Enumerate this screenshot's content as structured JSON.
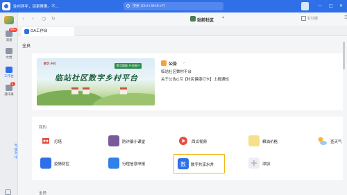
{
  "topbar": {
    "notice": "驻村两年，硕果累累。不...",
    "search_placeholder": "搜索 (Ctrl+Shift+F)",
    "window_controls": [
      "—",
      "□",
      "✕"
    ]
  },
  "sidebar": {
    "items": [
      {
        "label": "消息",
        "badge": "99+",
        "icon": "message-icon"
      },
      {
        "label": "文档",
        "icon": "document-icon"
      },
      {
        "label": "工作台",
        "icon": "workbench-icon",
        "active": true
      },
      {
        "label": "通讯录",
        "badge": "2",
        "icon": "contacts-icon"
      }
    ],
    "side_text": "无锡对比"
  },
  "nav": {
    "back": "‹",
    "forward": "›",
    "history": "◷",
    "refresh": "↻",
    "org_name": "站前社区",
    "org_caret": "▾",
    "right_label": "钉钉版",
    "more": "☰"
  },
  "tab": {
    "label": "OA工作台"
  },
  "main": {
    "section_title": "全员",
    "banner": {
      "brand": "数字 乡村",
      "slogan": "数字赋能 乡村振兴",
      "title": "临站社区数字乡村平台"
    },
    "notice": {
      "label": "公告",
      "arrow": "›",
      "lines": [
        "临站社区数村平台",
        "关于公告([习【村民健康打卡】上报通知"
      ]
    },
    "apps_section_label": "我的",
    "apps": [
      {
        "name": "灯塔",
        "color": "#e04b3f",
        "icon": "lighthouse-icon"
      },
      {
        "name": "防诈骗小课堂",
        "color": "#7a5a9a",
        "icon": "anti-fraud-icon"
      },
      {
        "name": "西瓜视频",
        "color": "#f0473c",
        "icon": "video-icon"
      },
      {
        "name": "粮油价格",
        "color": "#f1c232",
        "icon": "grain-price-icon"
      },
      {
        "name": "查天气",
        "color": "#4fa3e0",
        "icon": "weather-icon"
      },
      {
        "name": "疫情防控",
        "color": "#2f6fe8",
        "icon": "epidemic-icon"
      },
      {
        "name": "行程信息申报",
        "color": "#2f80e8",
        "icon": "travel-report-icon"
      },
      {
        "name": "数字共享水井",
        "color": "#2f6fe8",
        "icon": "water-well-icon",
        "highlight": true
      },
      {
        "name": "添加",
        "color": "#e8eaed",
        "icon": "add-icon"
      }
    ],
    "bottom_label": "全员"
  }
}
